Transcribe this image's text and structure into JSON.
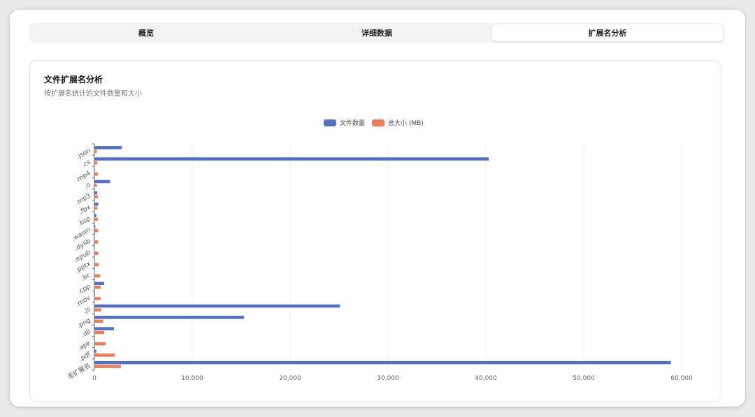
{
  "tabs": [
    {
      "label": "概览",
      "active": false
    },
    {
      "label": "详细数据",
      "active": false
    },
    {
      "label": "扩展名分析",
      "active": true
    }
  ],
  "card": {
    "title": "文件扩展名分析",
    "subtitle": "按扩展名统计的文件数量和大小"
  },
  "colors": {
    "count": "#5470c6",
    "size": "#ee7c55"
  },
  "chart_data": {
    "type": "bar",
    "orientation": "horizontal",
    "categories": [
      ".json",
      ".cs",
      ".mp4",
      ".o",
      ".mp3",
      ".fbx",
      ".bsp",
      ".wasm",
      ".dylib",
      ".epub",
      ".pptx",
      ".bc",
      ".cpp",
      ".mov",
      ".js",
      ".png",
      ".dll",
      ".apk",
      ".pdf",
      "无扩展名"
    ],
    "series": [
      {
        "name": "文件数量",
        "values": [
          2800,
          40300,
          50,
          1600,
          300,
          400,
          200,
          100,
          50,
          30,
          20,
          40,
          1000,
          60,
          25100,
          15300,
          2000,
          50,
          200,
          58900
        ]
      },
      {
        "name": "总大小 (MB)",
        "values": [
          250,
          300,
          350,
          250,
          350,
          300,
          350,
          380,
          400,
          400,
          450,
          600,
          650,
          650,
          700,
          900,
          1000,
          1150,
          2100,
          2700
        ]
      }
    ],
    "xlim": [
      0,
      60000
    ],
    "xticks": [
      0,
      10000,
      20000,
      30000,
      40000,
      50000,
      60000
    ],
    "xtick_labels": [
      "0",
      "10,000",
      "20,000",
      "30,000",
      "40,000",
      "50,000",
      "60,000"
    ],
    "grid": true,
    "legend": "top-center"
  }
}
